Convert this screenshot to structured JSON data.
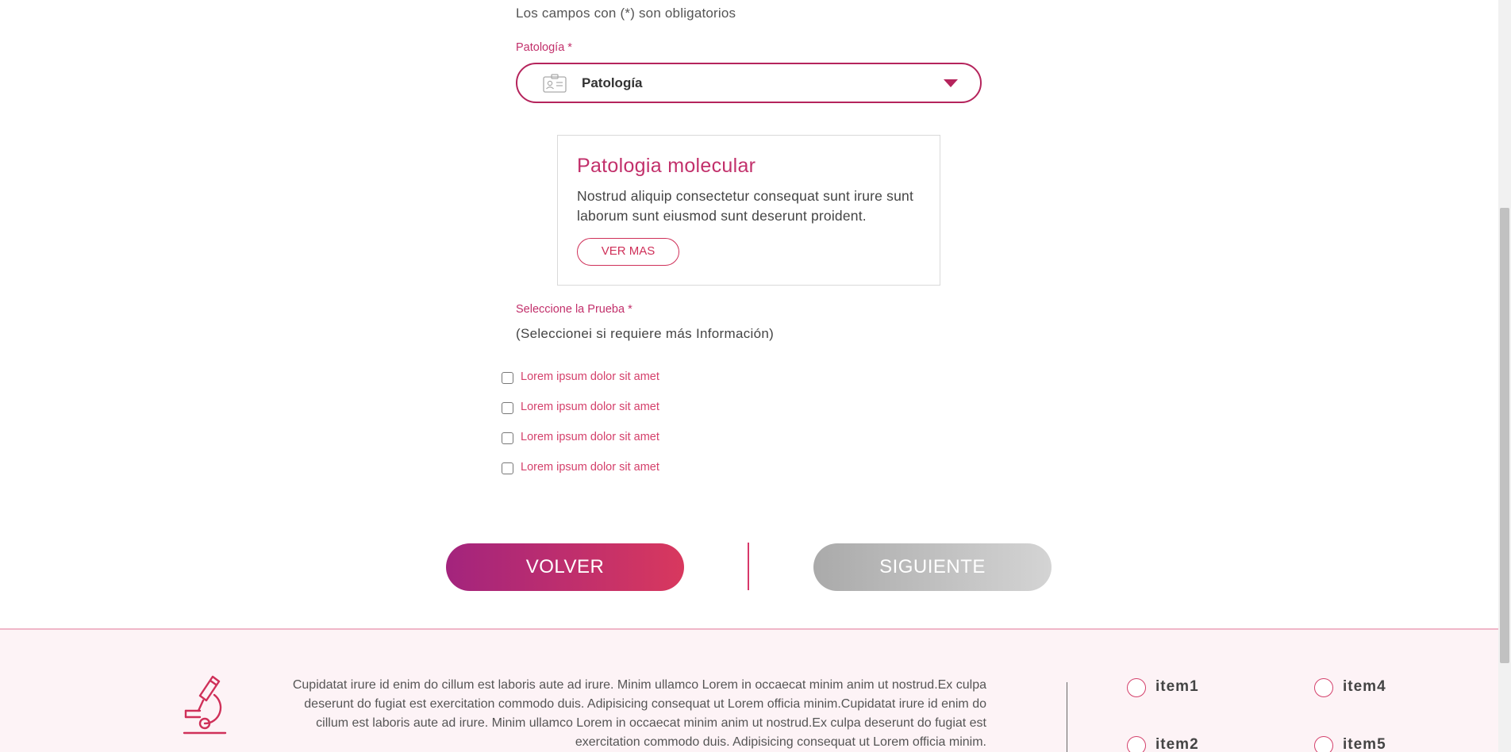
{
  "form": {
    "required_note": "Los campos con (*) son obligatorios",
    "patologia_label": "Patología *",
    "patologia_select": {
      "value": "Patología",
      "icon": "id-card-icon"
    },
    "card": {
      "title": "Patologia molecular",
      "text": "Nostrud aliquip consectetur consequat sunt irure sunt laborum sunt eiusmod sunt deserunt proident.",
      "button_label": "VER MAS"
    },
    "prueba_label": "Seleccione la Prueba *",
    "prueba_hint": "(Seleccionei si requiere más Información)",
    "options": [
      {
        "label": "Lorem ipsum dolor sit amet",
        "checked": false
      },
      {
        "label": "Lorem ipsum dolor sit amet",
        "checked": false
      },
      {
        "label": "Lorem ipsum dolor sit amet",
        "checked": false
      },
      {
        "label": "Lorem ipsum dolor sit amet",
        "checked": false
      }
    ]
  },
  "nav": {
    "back_label": "VOLVER",
    "next_label": "SIGUIENTE",
    "back_color": "#c2306b",
    "next_disabled": true
  },
  "footer": {
    "icon": "microscope-icon",
    "text": "Cupidatat irure id enim do cillum est laboris aute ad irure. Minim ullamco Lorem in occaecat minim anim ut nostrud.Ex culpa deserunt do fugiat est exercitation commodo duis. Adipisicing consequat ut Lorem officia minim.Cupidatat irure id enim do cillum est laboris aute ad irure. Minim ullamco Lorem in occaecat minim anim ut nostrud.Ex culpa deserunt do fugiat est exercitation commodo duis. Adipisicing consequat ut Lorem officia minim.",
    "items": [
      {
        "label": "item1"
      },
      {
        "label": "item2"
      },
      {
        "label": "item4"
      },
      {
        "label": "item5"
      }
    ]
  },
  "colors": {
    "accent": "#c2306b",
    "accent_light": "#d8385e",
    "footer_bg": "#fdf3f6"
  }
}
